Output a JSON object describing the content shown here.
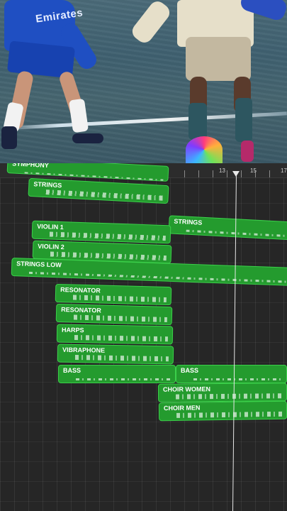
{
  "ruler": {
    "marks": [
      "13",
      "15",
      "17"
    ]
  },
  "tracks": [
    {
      "label": "SYMPHONY"
    },
    {
      "label": "STRINGS"
    },
    {
      "label": "STRINGS"
    },
    {
      "label": "VIOLIN 1"
    },
    {
      "label": "VIOLIN 2"
    },
    {
      "label": "STRINGS LOW"
    },
    {
      "label": "RESONATOR"
    },
    {
      "label": "RESONATOR"
    },
    {
      "label": "HARPS"
    },
    {
      "label": "VIBRAPHONE"
    },
    {
      "label": "BASS"
    },
    {
      "label": "BASS"
    },
    {
      "label": "CHOIR WOMEN"
    },
    {
      "label": "CHOIR MEN"
    }
  ],
  "video": {
    "shirt_text": "Emirates"
  },
  "colors": {
    "region": "#249b2e",
    "region_border": "#3bd04a",
    "background": "#262626"
  }
}
